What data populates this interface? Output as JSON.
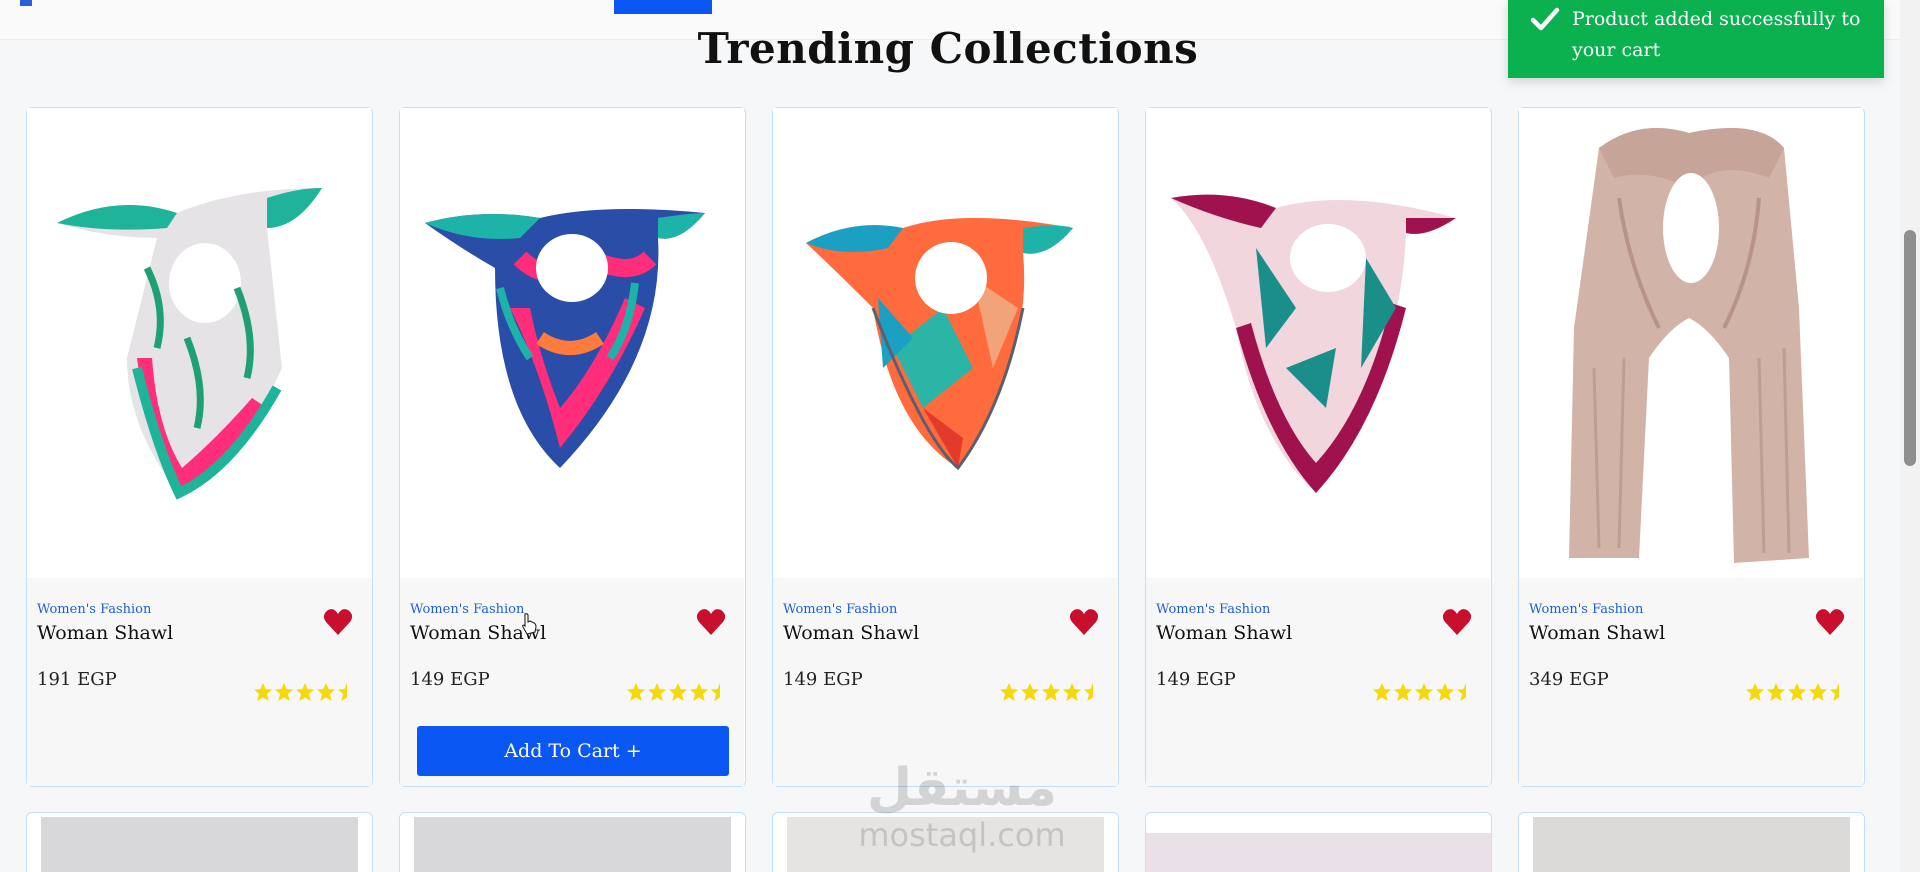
{
  "header": {
    "section_title": "Trending Collections"
  },
  "toast": {
    "message": "Product added successfully to your cart",
    "icon": "check-icon",
    "color": "#0bb14f"
  },
  "products": [
    {
      "category": "Women's Fashion",
      "name": "Woman Shawl",
      "price": "191 EGP",
      "rating": 4.5
    },
    {
      "category": "Women's Fashion",
      "name": "Woman Shawl",
      "price": "149 EGP",
      "rating": 4.5,
      "button": "Add To Cart"
    },
    {
      "category": "Women's Fashion",
      "name": "Woman Shawl",
      "price": "149 EGP",
      "rating": 4.5
    },
    {
      "category": "Women's Fashion",
      "name": "Woman Shawl",
      "price": "149 EGP",
      "rating": 4.5
    },
    {
      "category": "Women's Fashion",
      "name": "Woman Shawl",
      "price": "349 EGP",
      "rating": 4.5
    }
  ],
  "watermark": {
    "arabic": "مستقل",
    "latin": "mostaql.com"
  },
  "colors": {
    "accent": "#0b57f4",
    "heart": "#c8102e",
    "star": "#f5d90a",
    "card_border": "#c2dff7"
  }
}
